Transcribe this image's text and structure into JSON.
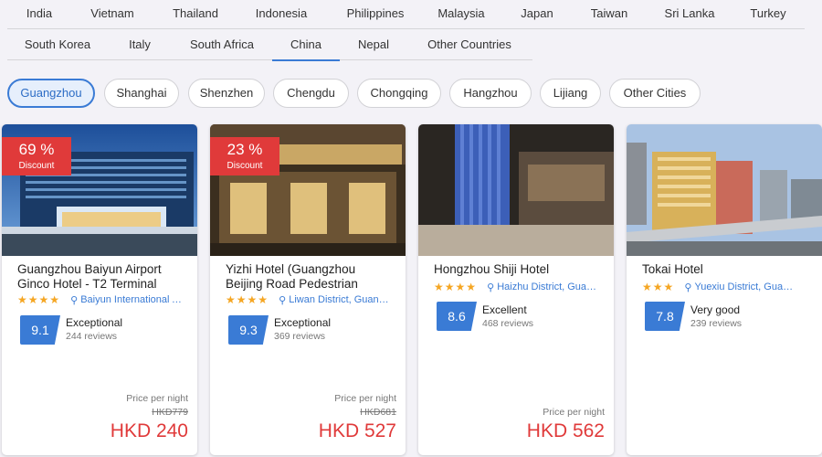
{
  "countries": {
    "row1": [
      "India",
      "Vietnam",
      "Thailand",
      "Indonesia",
      "Philippines",
      "Malaysia",
      "Japan",
      "Taiwan",
      "Sri Lanka",
      "Turkey"
    ],
    "row2": [
      "South Korea",
      "Italy",
      "South Africa",
      "China",
      "Nepal",
      "Other Countries"
    ],
    "active": "China"
  },
  "cities": {
    "items": [
      "Guangzhou",
      "Shanghai",
      "Shenzhen",
      "Chengdu",
      "Chongqing",
      "Hangzhou",
      "Lijiang",
      "Other Cities"
    ],
    "active": "Guangzhou"
  },
  "hotels": [
    {
      "name": "Guangzhou Baiyun Airport Ginco Hotel - T2 Terminal",
      "stars": "★★★★",
      "location": "Baiyun International Airport",
      "score": "9.1",
      "rating": "Exceptional",
      "reviews": "244 reviews",
      "discount_pct": "69 %",
      "discount_label": "Discount",
      "price_label": "Price per night",
      "original_price": "HKD779",
      "price": "HKD 240"
    },
    {
      "name": "Yizhi Hotel (Guangzhou Beijing Road Pedestrian Street)",
      "stars": "★★★★",
      "location": "Liwan District, Guangzhou",
      "score": "9.3",
      "rating": "Exceptional",
      "reviews": "369 reviews",
      "discount_pct": "23 %",
      "discount_label": "Discount",
      "price_label": "Price per night",
      "original_price": "HKD681",
      "price": "HKD 527"
    },
    {
      "name": "Hongzhou Shiji Hotel",
      "stars": "★★★★",
      "location": "Haizhu District, Guangzhou",
      "score": "8.6",
      "rating": "Excellent",
      "reviews": "468 reviews",
      "price_label": "Price per night",
      "price": "HKD 562"
    },
    {
      "name": "Tokai Hotel",
      "stars": "★★★",
      "location": "Yuexiu District, Guangzhou",
      "score": "7.8",
      "rating": "Very good",
      "reviews": "239 reviews"
    }
  ],
  "icons": {
    "location": "map-pin-icon",
    "star": "star-icon"
  },
  "colors": {
    "accent": "#3a7bd5",
    "discount": "#e03a3a",
    "price": "#e03a3a",
    "stars": "#f5a623"
  }
}
